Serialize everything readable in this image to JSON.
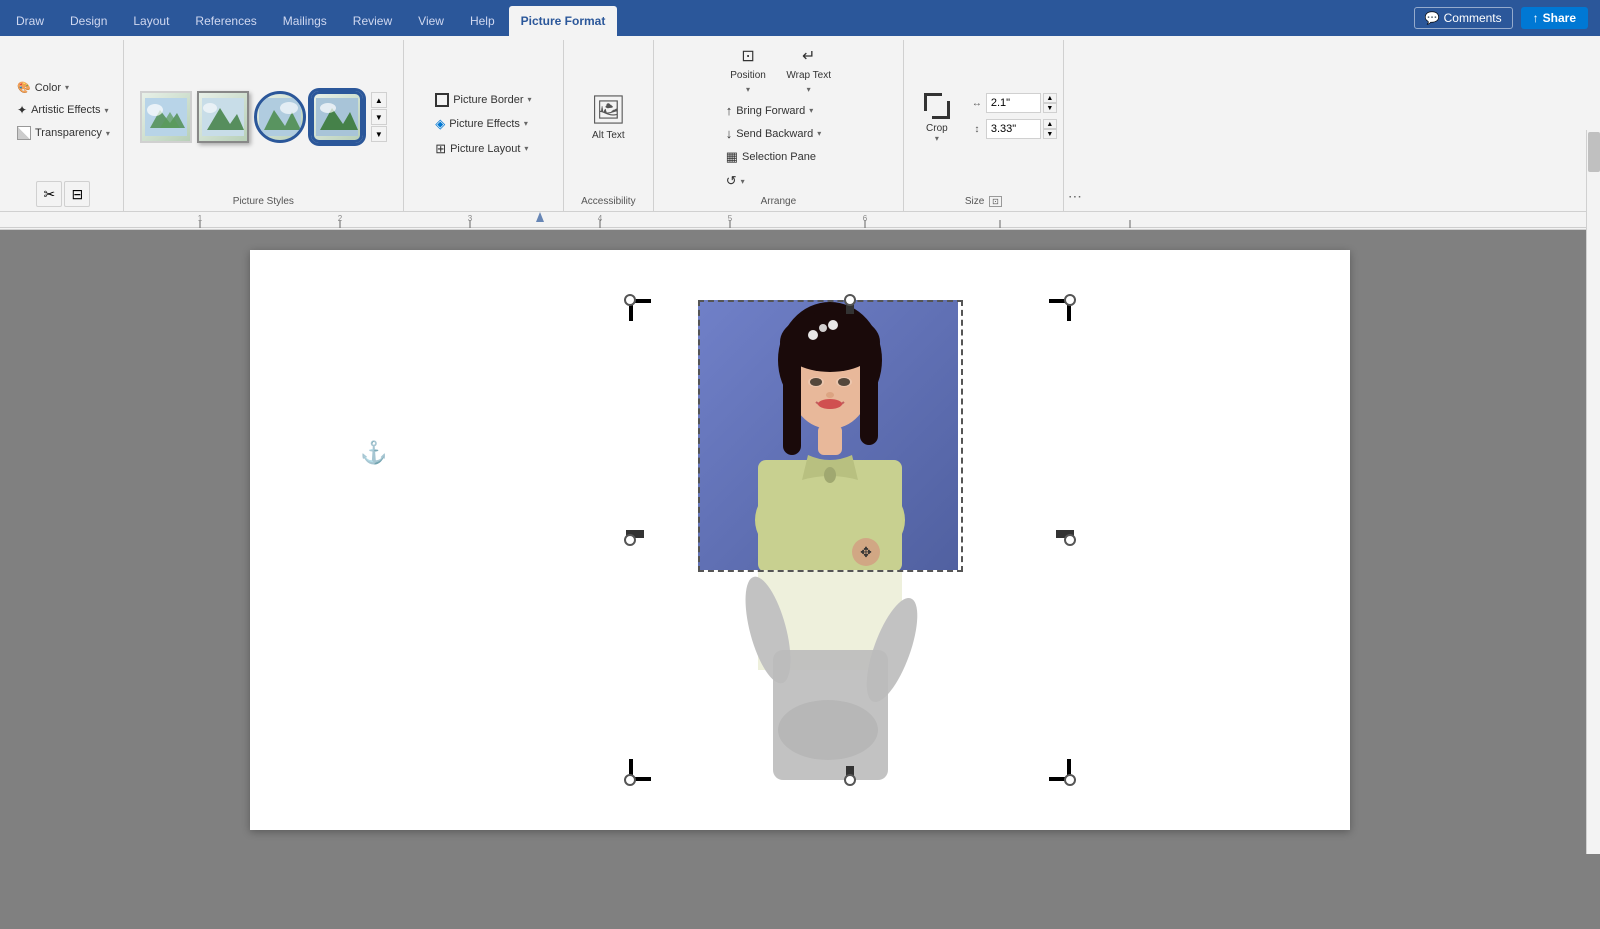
{
  "tabs": {
    "items": [
      {
        "label": "Draw",
        "active": false
      },
      {
        "label": "Design",
        "active": false
      },
      {
        "label": "Layout",
        "active": false
      },
      {
        "label": "References",
        "active": false
      },
      {
        "label": "Mailings",
        "active": false
      },
      {
        "label": "Review",
        "active": false
      },
      {
        "label": "View",
        "active": false
      },
      {
        "label": "Help",
        "active": false
      },
      {
        "label": "Picture Format",
        "active": true
      }
    ],
    "header_buttons": {
      "comments": "Comments",
      "share": "Share"
    }
  },
  "ribbon": {
    "adjust_group": {
      "label": "",
      "color_btn": "Color",
      "artistic_btn": "Artistic Effects",
      "transparency_btn": "Transparency"
    },
    "picture_styles_group": {
      "label": "Picture Styles"
    },
    "picture_tools_group": {
      "picture_border_btn": "Picture Border",
      "picture_effects_btn": "Picture Effects",
      "picture_layout_btn": "Picture Layout"
    },
    "alt_text_group": {
      "label": "Accessibility",
      "alt_text_btn": "Alt Text"
    },
    "arrange_group": {
      "label": "Arrange",
      "position_btn": "Position",
      "wrap_text_btn": "Wrap Text",
      "bring_forward_btn": "Bring Forward",
      "send_backward_btn": "Send Backward",
      "selection_pane_btn": "Selection Pane",
      "rotate_btn": "Rotate"
    },
    "crop_group": {
      "label": "Size",
      "crop_btn": "Crop",
      "width_label": "Width",
      "height_label": "Height",
      "width_value": "2.1\"",
      "height_value": "3.33\""
    }
  },
  "document": {
    "photo_description": "Portrait photo of a young woman smiling, blue background, light green top",
    "anchor_symbol": "⚓"
  },
  "icons": {
    "color": "🎨",
    "artistic": "✨",
    "transparency": "◻",
    "picture_border": "▭",
    "picture_effects": "◈",
    "picture_layout": "⊞",
    "alt_text": "🖼",
    "position": "⊡",
    "wrap_text": "↵",
    "bring_forward": "↑",
    "send_backward": "↓",
    "selection_pane": "▦",
    "rotate": "↺",
    "crop": "⊡",
    "comments": "💬",
    "share": "↑",
    "dropdown_arrow": "▾",
    "scroll_up": "▲",
    "scroll_down": "▼",
    "scroll_more": "▼"
  }
}
